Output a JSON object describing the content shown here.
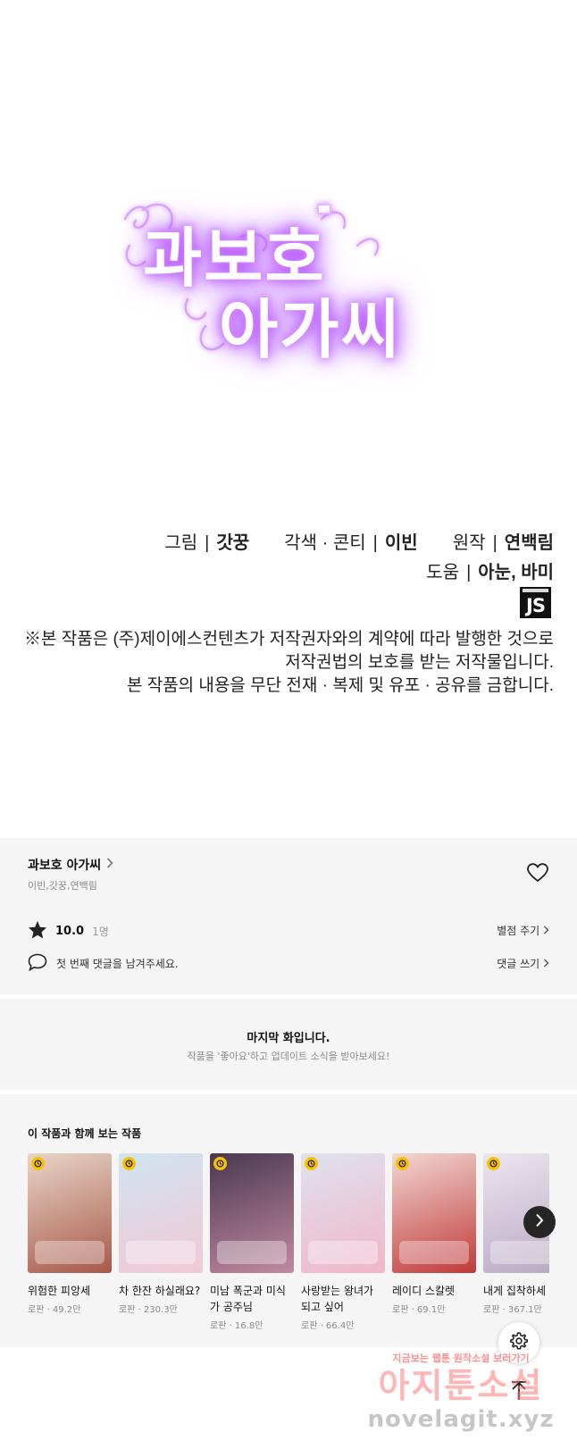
{
  "comic": {
    "logo_line1": "과보호",
    "logo_line2": "아가씨",
    "credits": {
      "art_label": "그림",
      "art_value": "갓꿍",
      "adapt_label": "각색 · 콘티",
      "adapt_value": "이빈",
      "original_label": "원작",
      "original_value": "연백림",
      "assist_label": "도움",
      "assist_value": "아눈, 바미",
      "separator": "|"
    },
    "publisher_badge": "JS",
    "notice_lines": [
      "※본 작품은 (주)제이에스컨텐츠가 저작권자와의 계약에 따라 발행한 것으로",
      "저작권법의 보호를 받는 저작물입니다.",
      "본 작품의 내용을 무단 전재 · 복제 및 유포 · 공유를 금합니다."
    ]
  },
  "info": {
    "title": "과보호 아가씨",
    "authors": "이빈,갓꿍,연백림",
    "rating": "10.0",
    "rating_count": "1명",
    "rate_link": "별점 주기",
    "comment_prompt": "첫 번째 댓글을 남겨주세요.",
    "comment_link": "댓글 쓰기",
    "icons": {
      "heart": "heart-icon",
      "star": "star-icon",
      "comment": "speech-bubble-icon",
      "chevron": "chevron-right-icon"
    }
  },
  "last_episode": {
    "title": "마지막 화입니다.",
    "subtitle": "작품을 '좋아요'하고 업데이트 소식을 받아보세요!"
  },
  "recommendations": {
    "heading": "이 작품과 함께 보는 작품",
    "items": [
      {
        "name": "위험한 피앙세",
        "meta": "로판 · 49.2만",
        "color1": "#e8d6c8",
        "color2": "#a8584a"
      },
      {
        "name": "차 한잔 하실래요?",
        "meta": "로판 · 230.3만",
        "color1": "#cfe4f0",
        "color2": "#f2c8d4"
      },
      {
        "name": "미남 폭군과 미식가 공주님",
        "meta": "로판 · 16.8만",
        "color1": "#4a3850",
        "color2": "#c08aa0"
      },
      {
        "name": "사랑받는 왕녀가 되고 싶어",
        "meta": "로판 · 66.4만",
        "color1": "#dfe2ee",
        "color2": "#f0b6c8"
      },
      {
        "name": "레이디 스칼렛",
        "meta": "로판 · 69.1만",
        "color1": "#f2d8d2",
        "color2": "#c03a3a"
      },
      {
        "name": "내게 집착하세",
        "meta": "로판 · 367.1만",
        "color1": "#ece6ee",
        "color2": "#b8a8c4"
      }
    ],
    "next_icon": "chevron-right-icon"
  },
  "floating": {
    "settings_icon": "gear-icon",
    "top_icon": "arrow-up-icon"
  },
  "watermark": {
    "small": "지금보는 웹툰 원작소설 보러가기",
    "big": "아지툰소설",
    "url": "novelagit.xyz"
  }
}
